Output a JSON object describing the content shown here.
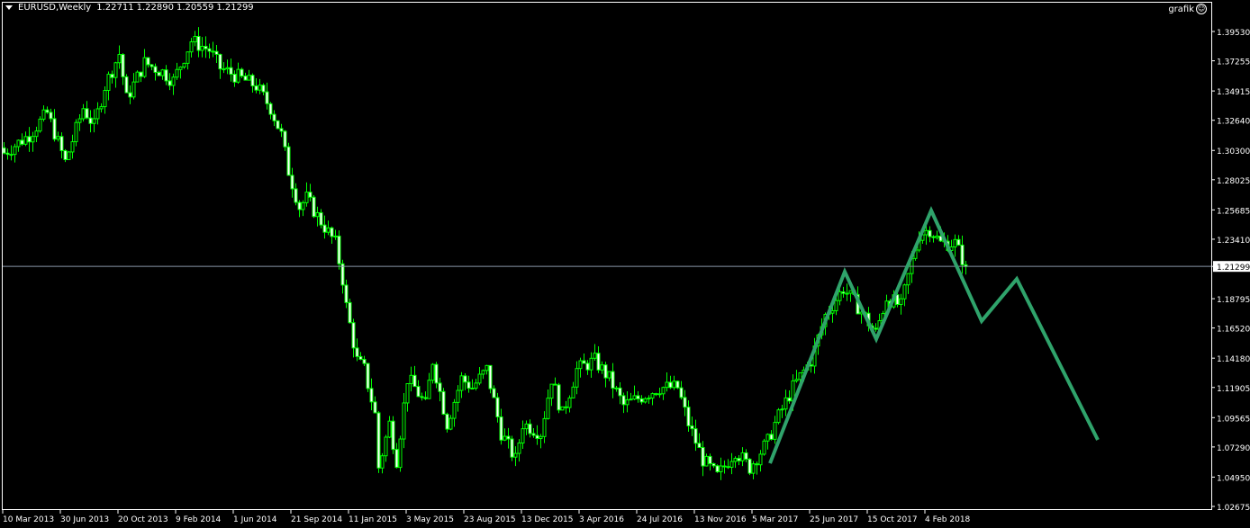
{
  "header": {
    "symbol": "EURUSD,Weekly",
    "open": "1.22711",
    "high": "1.22890",
    "low": "1.20559",
    "close": "1.21299"
  },
  "expert": {
    "label": "grafik",
    "icon": "smiley-icon"
  },
  "colors": {
    "background": "#000000",
    "candle": "#00ff00",
    "bear_body": "#ffffff",
    "zigzag": "#2fa36b",
    "price_line": "#8a96a8",
    "axis": "#ffffff"
  },
  "chart_data": {
    "type": "candlestick",
    "title": "EURUSD,Weekly",
    "current_price": "1.21299",
    "ylim": [
      1.02675,
      1.3953
    ],
    "y_ticks": [
      "1.39530",
      "1.37255",
      "1.34915",
      "1.32640",
      "1.30300",
      "1.28025",
      "1.25685",
      "1.23410",
      "1.21299",
      "1.18795",
      "1.16520",
      "1.14180",
      "1.11905",
      "1.09565",
      "1.07290",
      "1.04950",
      "1.02675"
    ],
    "x_ticks": [
      "10 Mar 2013",
      "30 Jun 2013",
      "20 Oct 2013",
      "9 Feb 2014",
      "1 Jun 2014",
      "21 Sep 2014",
      "11 Jan 2015",
      "3 May 2015",
      "23 Aug 2015",
      "13 Dec 2015",
      "3 Apr 2016",
      "24 Jul 2016",
      "13 Nov 2016",
      "5 Mar 2017",
      "25 Jun 2017",
      "15 Oct 2017",
      "4 Feb 2018"
    ],
    "weeks_per_x_tick": 16,
    "close_path_week_price": [
      [
        0,
        1.301
      ],
      [
        7,
        1.315
      ],
      [
        12,
        1.332
      ],
      [
        17,
        1.294
      ],
      [
        22,
        1.336
      ],
      [
        25,
        1.322
      ],
      [
        28,
        1.353
      ],
      [
        32,
        1.378
      ],
      [
        34,
        1.343
      ],
      [
        39,
        1.371
      ],
      [
        44,
        1.364
      ],
      [
        47,
        1.357
      ],
      [
        52,
        1.388
      ],
      [
        57,
        1.381
      ],
      [
        60,
        1.367
      ],
      [
        65,
        1.36
      ],
      [
        70,
        1.353
      ],
      [
        74,
        1.336
      ],
      [
        77,
        1.315
      ],
      [
        79,
        1.287
      ],
      [
        82,
        1.259
      ],
      [
        84,
        1.266
      ],
      [
        87,
        1.252
      ],
      [
        92,
        1.231
      ],
      [
        94,
        1.203
      ],
      [
        95,
        1.182
      ],
      [
        98,
        1.14
      ],
      [
        100,
        1.133
      ],
      [
        103,
        1.098
      ],
      [
        104,
        1.057
      ],
      [
        107,
        1.091
      ],
      [
        109,
        1.063
      ],
      [
        112,
        1.126
      ],
      [
        114,
        1.119
      ],
      [
        117,
        1.105
      ],
      [
        119,
        1.14
      ],
      [
        123,
        1.091
      ],
      [
        127,
        1.126
      ],
      [
        130,
        1.119
      ],
      [
        134,
        1.133
      ],
      [
        138,
        1.084
      ],
      [
        142,
        1.063
      ],
      [
        144,
        1.091
      ],
      [
        149,
        1.084
      ],
      [
        152,
        1.126
      ],
      [
        155,
        1.098
      ],
      [
        159,
        1.133
      ],
      [
        164,
        1.14
      ],
      [
        168,
        1.126
      ],
      [
        172,
        1.105
      ],
      [
        177,
        1.112
      ],
      [
        182,
        1.119
      ],
      [
        187,
        1.119
      ],
      [
        190,
        1.091
      ],
      [
        194,
        1.063
      ],
      [
        198,
        1.05
      ],
      [
        203,
        1.07
      ],
      [
        207,
        1.057
      ],
      [
        212,
        1.077
      ],
      [
        214,
        1.091
      ],
      [
        219,
        1.119
      ],
      [
        224,
        1.14
      ],
      [
        228,
        1.175
      ],
      [
        233,
        1.196
      ],
      [
        237,
        1.182
      ],
      [
        242,
        1.161
      ],
      [
        245,
        1.189
      ],
      [
        249,
        1.182
      ],
      [
        252,
        1.217
      ],
      [
        254,
        1.238
      ],
      [
        257,
        1.242
      ],
      [
        260,
        1.231
      ],
      [
        264,
        1.231
      ],
      [
        267,
        1.213
      ]
    ],
    "zigzag_week_price": [
      [
        213,
        1.0602
      ],
      [
        233.75,
        1.2089
      ],
      [
        242.5,
        1.1566
      ],
      [
        257.75,
        1.2564
      ],
      [
        271.75,
        1.1706
      ],
      [
        281.5,
        1.2033
      ],
      [
        304,
        1.0784
      ]
    ]
  }
}
